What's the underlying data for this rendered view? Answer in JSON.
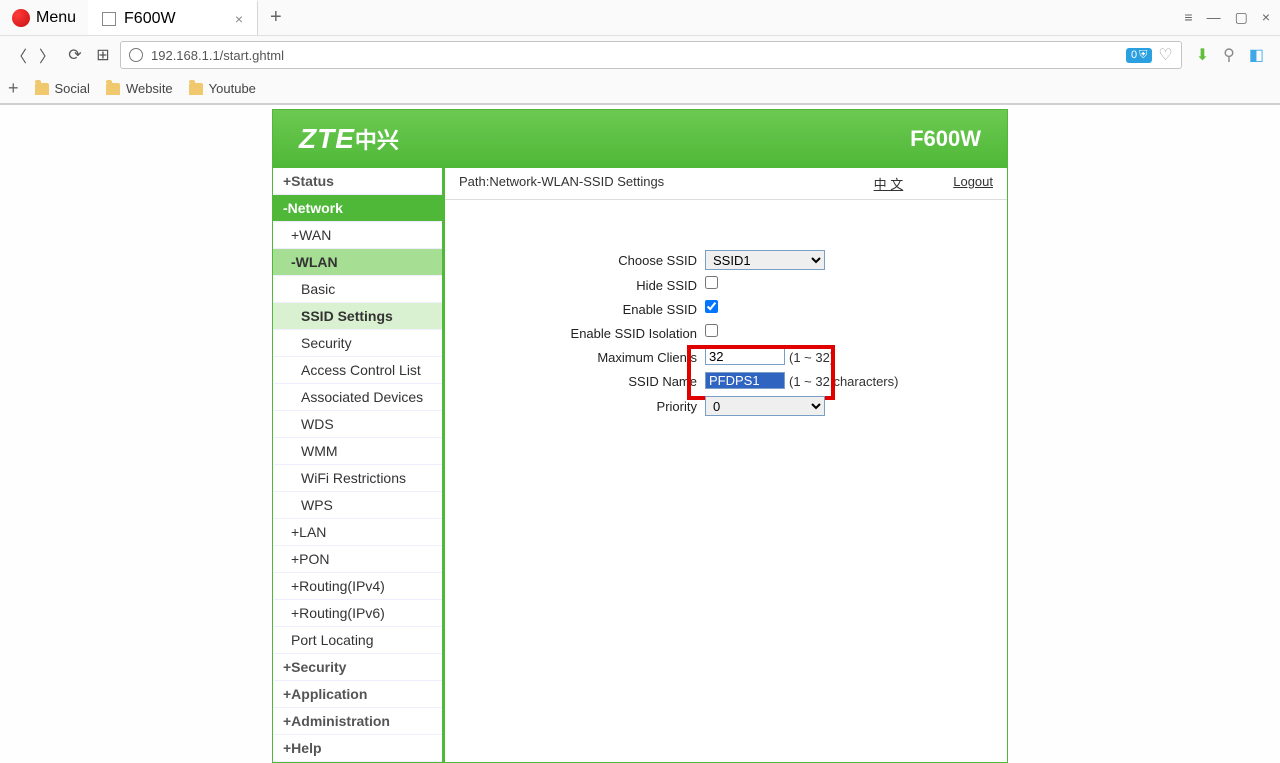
{
  "browser": {
    "menu": "Menu",
    "tab_title": "F600W",
    "url": "192.168.1.1/start.ghtml",
    "block_count": "0"
  },
  "bookmarks": [
    "Social",
    "Website",
    "Youtube"
  ],
  "header": {
    "logo": "ZTE",
    "logo_cn": "中兴",
    "product": "F600W"
  },
  "path_bar": {
    "path": "Path:Network-WLAN-SSID Settings",
    "lang": "中 文",
    "logout": "Logout"
  },
  "sidebar": {
    "status": "+Status",
    "network": "-Network",
    "wan": "+WAN",
    "wlan": "-WLAN",
    "leaves": {
      "basic": "Basic",
      "ssid_settings": "SSID Settings",
      "security": "Security",
      "acl": "Access Control List",
      "assoc": "Associated Devices",
      "wds": "WDS",
      "wmm": "WMM",
      "wifi_restrict": "WiFi Restrictions",
      "wps": "WPS"
    },
    "lan": "+LAN",
    "pon": "+PON",
    "r4": "+Routing(IPv4)",
    "r6": "+Routing(IPv6)",
    "port": "Port Locating",
    "security": "+Security",
    "application": "+Application",
    "administration": "+Administration",
    "help": "+Help"
  },
  "form": {
    "choose_ssid": {
      "label": "Choose SSID",
      "value": "SSID1"
    },
    "hide_ssid": {
      "label": "Hide SSID",
      "checked": false
    },
    "enable_ssid": {
      "label": "Enable SSID",
      "checked": true
    },
    "isolation": {
      "label": "Enable SSID Isolation",
      "checked": false
    },
    "max_clients": {
      "label": "Maximum Clients",
      "value": "32",
      "hint": "(1 ~ 32)"
    },
    "ssid_name": {
      "label": "SSID Name",
      "value": "PFDPS1",
      "hint": "(1 ~ 32 characters)"
    },
    "priority": {
      "label": "Priority",
      "value": "0"
    }
  }
}
